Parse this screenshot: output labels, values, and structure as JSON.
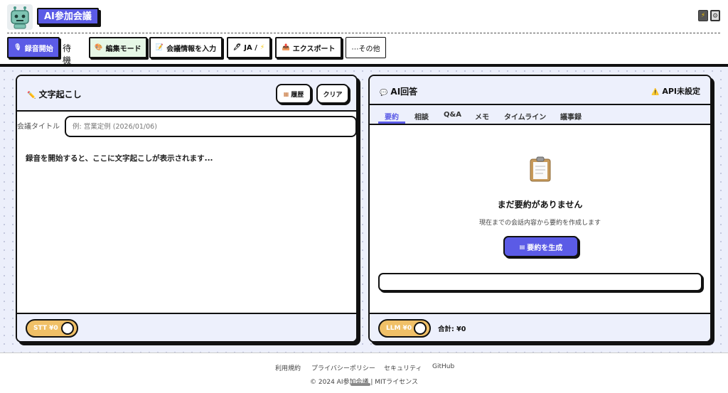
{
  "header": {
    "app_title": "AI参加会議",
    "icons": [
      "robot-logo-icon",
      "lightning-icon",
      "gear-icon"
    ]
  },
  "toolbar": {
    "record_label": "録音開始",
    "status": "待機中",
    "edit_mode_label": "編集モード",
    "meeting_info_label": "会議情報を入力",
    "language_label": "JA / ",
    "export_label": "エクスポート",
    "more_label": "⋯その他"
  },
  "transcript": {
    "title": "文字起こし",
    "history_label": "履歴",
    "clear_label": "クリア",
    "meeting_title_label": "会議タイトル",
    "meeting_title_placeholder": "例: 営業定例 (2026/01/06)",
    "meeting_title_value": "",
    "placeholder_text": "録音を開始すると、ここに文字起こしが表示されます...",
    "stt_cost": "STT ¥0"
  },
  "ai": {
    "title": "AI回答",
    "api_status": "API未設定",
    "tabs": [
      "要約",
      "相談",
      "Q&A",
      "メモ",
      "タイムライン",
      "議事録"
    ],
    "active_tab": "要約",
    "empty_title": "まだ要約がありません",
    "empty_desc": "現在までの会話内容から要約を作成します",
    "generate_label": "要約を生成",
    "llm_cost": "LLM ¥0",
    "total": "合計: ¥0"
  },
  "footer": {
    "links": [
      "利用規約",
      "プライバシーポリシー",
      "セキュリティ",
      "GitHub"
    ],
    "copyright": "© 2024 AI参加会議 | MITライセンス"
  },
  "colors": {
    "accent": "#5b5be6",
    "edit_mode_bg": "#e6f7e6",
    "pill": "#f0c067",
    "panel_bg": "#edf0fc",
    "main_bg": "#eceffb"
  }
}
